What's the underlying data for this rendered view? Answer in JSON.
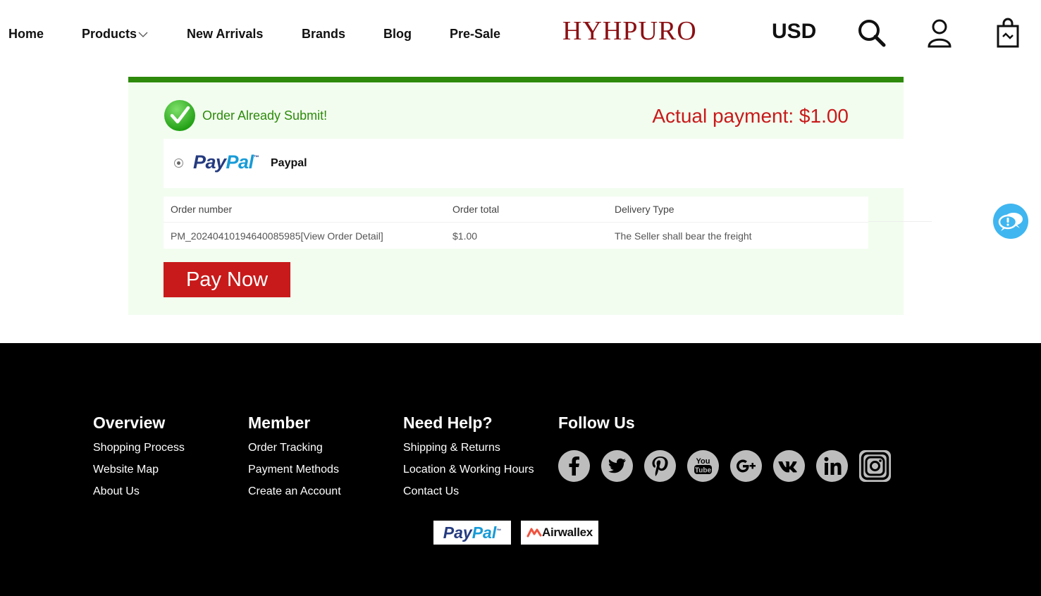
{
  "header": {
    "nav": [
      {
        "label": "Home"
      },
      {
        "label": "Products"
      },
      {
        "label": "New Arrivals"
      },
      {
        "label": "Brands"
      },
      {
        "label": "Blog"
      },
      {
        "label": "Pre-Sale"
      }
    ],
    "logo": "HYHPURO",
    "currency": "USD",
    "icons": [
      "search-icon",
      "user-icon",
      "cart-icon"
    ]
  },
  "order": {
    "status": "Order Already Submit!",
    "actual_payment": "Actual payment: $1.00",
    "payment_method": {
      "logo_part1": "Pay",
      "logo_part2": "Pal",
      "logo_tm": "™",
      "name": "Paypal"
    },
    "table": {
      "headers": [
        "Order number",
        "Order total",
        "Delivery Type"
      ],
      "row": {
        "order_number": "PM_20240410194640085985",
        "view_link": "[View Order Detail]",
        "order_total": "$1.00",
        "delivery_type": "The Seller shall bear the freight"
      }
    },
    "pay_button": "Pay Now"
  },
  "footer": {
    "columns": [
      {
        "title": "Overview",
        "links": [
          "Shopping Process",
          "Website Map",
          "About Us"
        ]
      },
      {
        "title": "Member",
        "links": [
          "Order Tracking",
          "Payment Methods",
          "Create an Account"
        ]
      },
      {
        "title": "Need Help?",
        "links": [
          "Shipping & Returns",
          "Location & Working Hours",
          "Contact Us"
        ]
      },
      {
        "title": "Follow Us",
        "links": []
      }
    ],
    "socials": [
      "facebook-icon",
      "twitter-icon",
      "pinterest-icon",
      "youtube-icon",
      "google-plus-icon",
      "vk-icon",
      "linkedin-icon",
      "instagram-icon"
    ],
    "payment_logos": {
      "paypal_a": "Pay",
      "paypal_b": "Pal",
      "paypal_tm": "™",
      "airwallex": "Airwallex"
    }
  },
  "colors": {
    "accent_green": "#2d8a0b",
    "accent_red": "#c81a1a",
    "logo_red": "#8b1014",
    "panel_bg": "#f2fdef",
    "chat_blue": "#3fb6f0"
  }
}
